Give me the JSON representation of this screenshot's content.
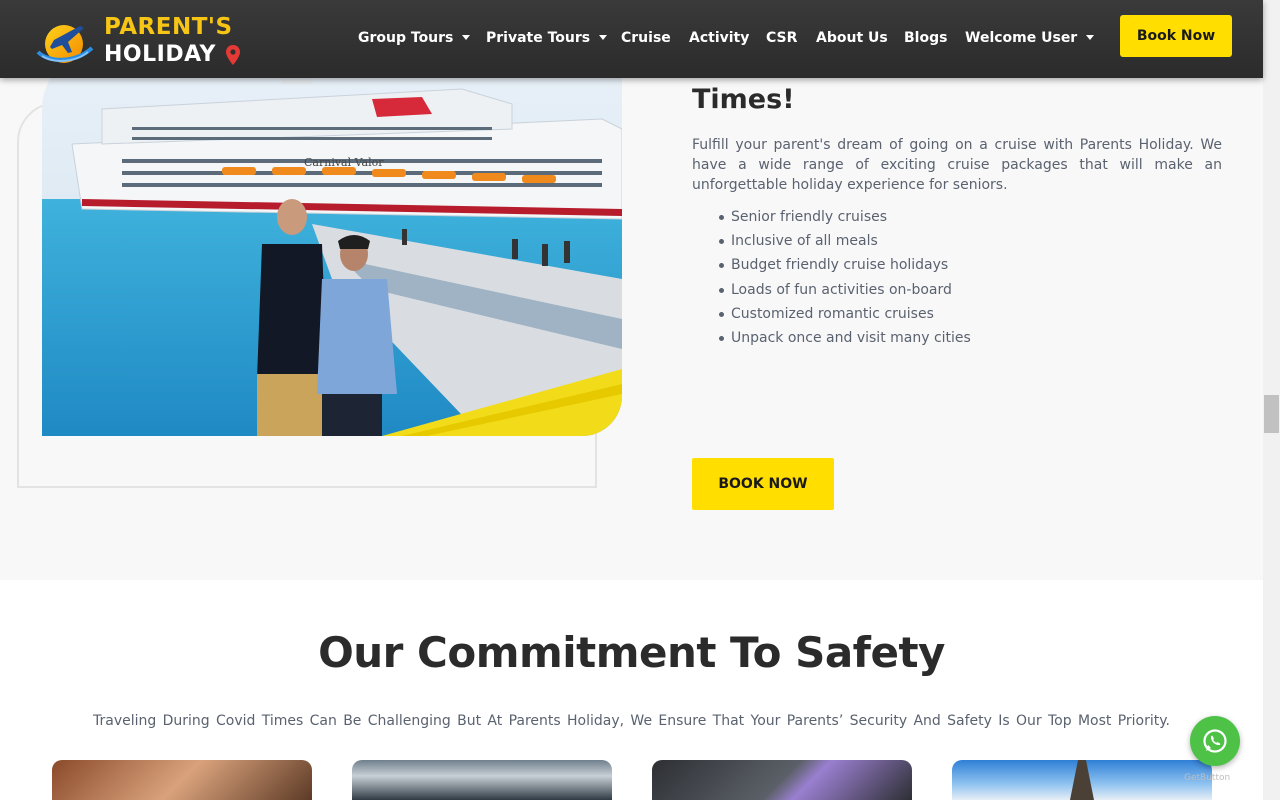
{
  "header": {
    "logo": {
      "line1": "PARENT'S",
      "line2": "HOLIDAY"
    },
    "nav": [
      {
        "label": "Group Tours",
        "dropdown": true
      },
      {
        "label": "Private Tours",
        "dropdown": true
      },
      {
        "label": "Cruise",
        "dropdown": false
      },
      {
        "label": "Activity",
        "dropdown": false
      },
      {
        "label": "CSR",
        "dropdown": false
      },
      {
        "label": "About Us",
        "dropdown": false
      },
      {
        "label": "Blogs",
        "dropdown": false
      },
      {
        "label": "Welcome User",
        "dropdown": true
      }
    ],
    "cta_label": "Book Now"
  },
  "cruise": {
    "title": "Let Your Parents Cruise Into Good Times!",
    "description": "Fulfill your parent's dream of going on a cruise with Parents Holiday. We have a wide range of exciting cruise packages that will make an unforgettable holiday experience for seniors.",
    "features": [
      "Senior friendly cruises",
      "Inclusive of all meals",
      "Budget friendly cruise holidays",
      "Loads of fun activities on-board",
      "Customized romantic cruises",
      "Unpack once and visit many cities"
    ],
    "button_label": "BOOK NOW",
    "ship_name": "Carnival Valor"
  },
  "safety": {
    "title": "Our Commitment To Safety",
    "description": "Traveling During Covid Times Can Be Challenging But At Parents Holiday, We Ensure That Your Parents’ Security And Safety Is Our Top Most Priority."
  },
  "widgets": {
    "getbutton_label": "GetButton"
  },
  "colors": {
    "accent": "#ffde00",
    "header_bg": "#2f2f2f",
    "logo_yellow": "#f7c515",
    "whatsapp": "#4dc247"
  }
}
